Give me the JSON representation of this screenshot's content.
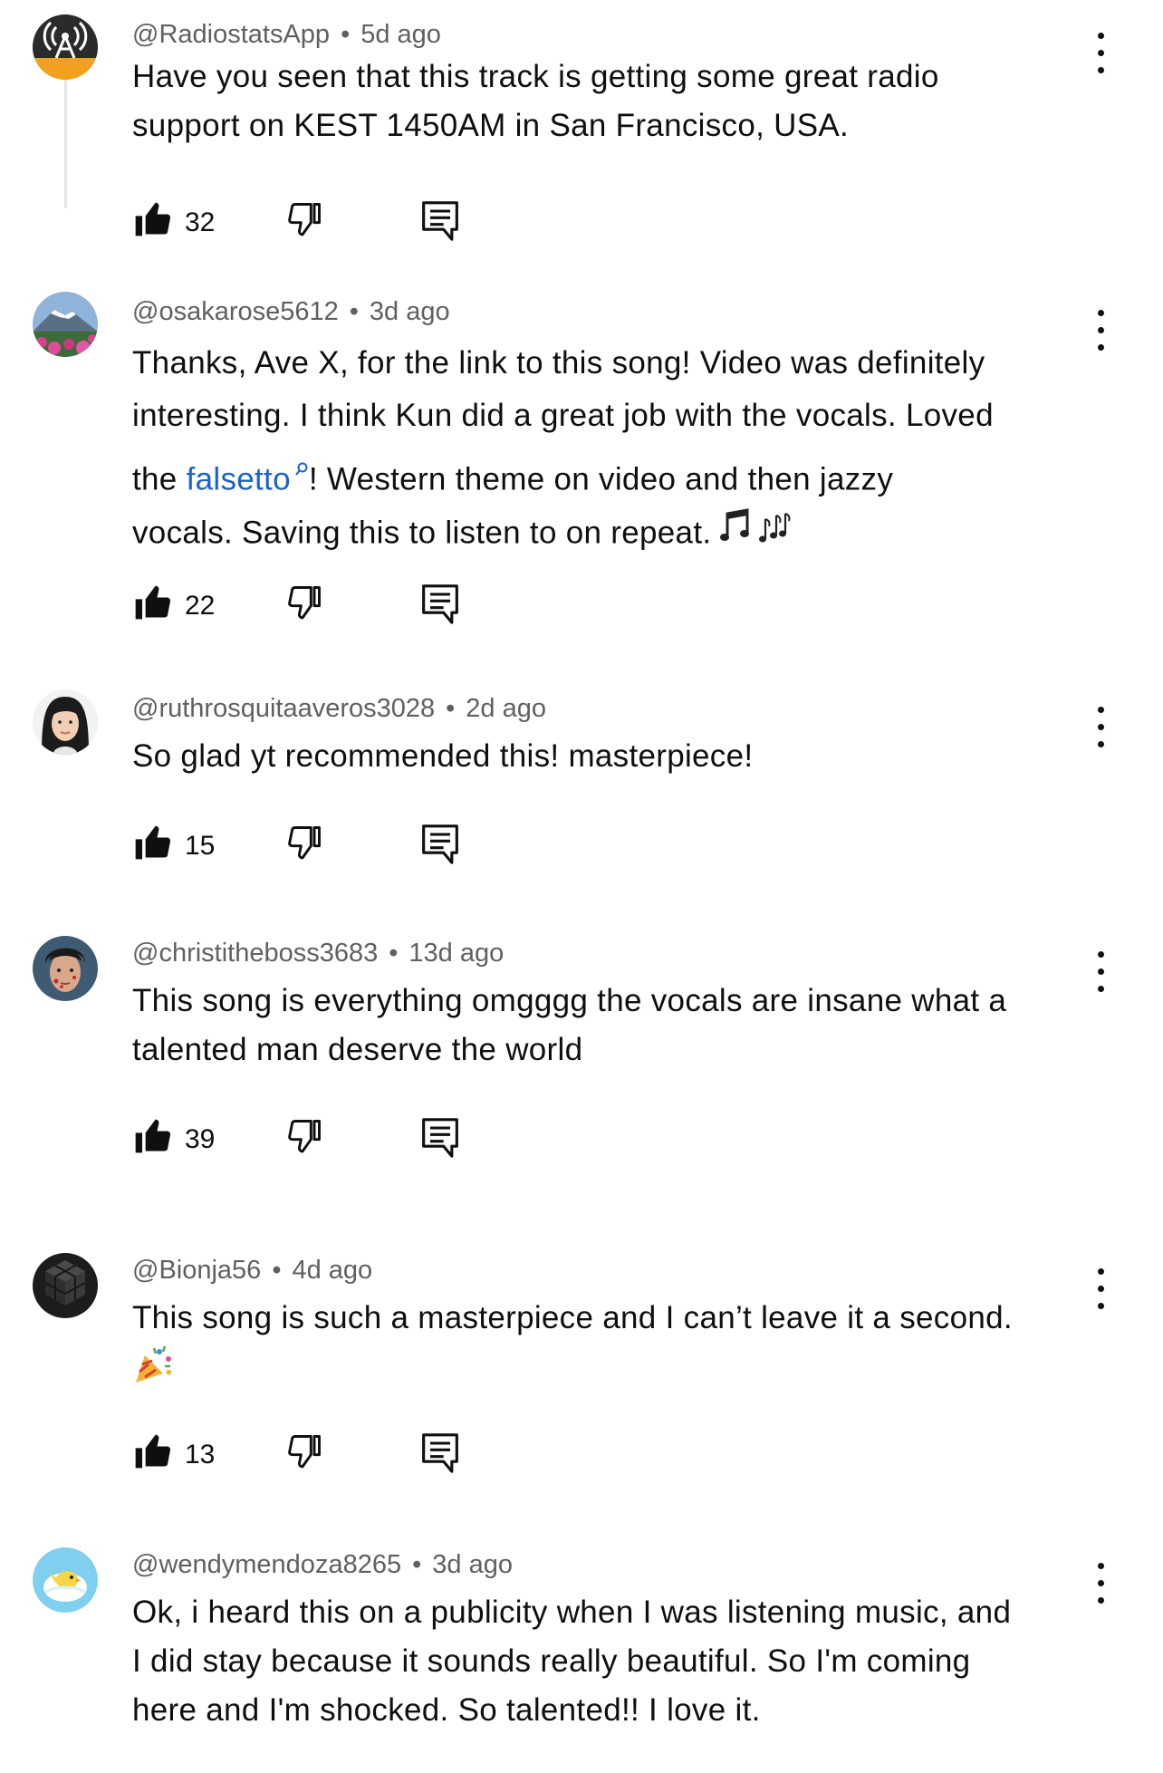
{
  "comments": [
    {
      "handle": "@RadiostatsApp",
      "age": "5d ago",
      "lines": [
        "Have you seen that this track is getting some great radio",
        "support on KEST 1450AM in San Francisco, USA."
      ],
      "likes": "32",
      "avatar": "radio-tower-avatar"
    },
    {
      "handle": "@osakarose5612",
      "age": "3d ago",
      "lines": [
        "Thanks, Ave X, for the link to this song!  Video was definitely",
        "interesting. I think Kun did a great job with the vocals. Loved"
      ],
      "line3_prefix": "the ",
      "link_text": "falsetto",
      "line3_suffix": "!  Western theme on video and then jazzy",
      "line4": "vocals. Saving this to listen to on repeat.",
      "likes": "22",
      "avatar": "mountain-photo-avatar"
    },
    {
      "handle": "@ruthrosquitaaveros3028",
      "age": "2d ago",
      "lines": [
        "So glad yt recommended this! masterpiece!"
      ],
      "likes": "15",
      "avatar": "woman-portrait-avatar"
    },
    {
      "handle": "@christitheboss3683",
      "age": "13d ago",
      "lines": [
        "This song is everything omgggg the vocals are insane what a",
        "talented man deserve the world"
      ],
      "likes": "39",
      "avatar": "man-portrait-avatar"
    },
    {
      "handle": "@Bionja56",
      "age": "4d ago",
      "lines": [
        "This song is such a masterpiece and I can’t leave it a second."
      ],
      "likes": "13",
      "avatar": "dark-cubes-avatar"
    },
    {
      "handle": "@wendymendoza8265",
      "age": "3d ago",
      "lines": [
        "Ok, i heard this on a publicity when I was listening music, and",
        "I did stay because it sounds really beautiful. So I'm coming",
        "here and I'm shocked.  So talented!! I love it."
      ],
      "avatar": "bird-cartoon-avatar"
    }
  ],
  "separator": "•",
  "colors": {
    "text": "#0f0f0f",
    "meta": "#606060",
    "link": "#1a63c9",
    "thread_line": "#e5e5e5"
  },
  "icons": [
    "like-icon",
    "dislike-icon",
    "reply-icon",
    "more-options-icon",
    "search-icon",
    "music-notes-icon",
    "party-popper-icon"
  ]
}
